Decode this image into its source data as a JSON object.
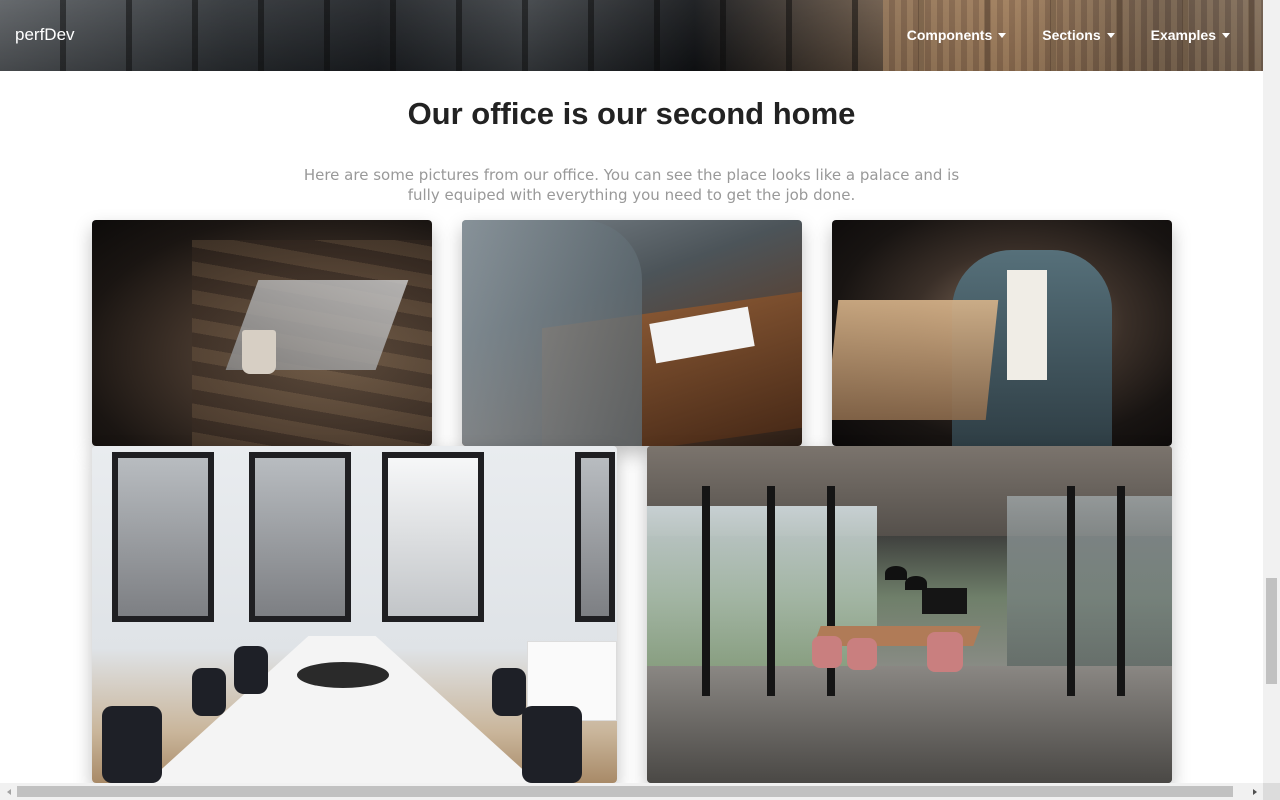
{
  "navbar": {
    "brand": "perfDev",
    "items": [
      {
        "label": "Components"
      },
      {
        "label": "Sections"
      },
      {
        "label": "Examples"
      }
    ]
  },
  "section": {
    "title": "Our office is our second home",
    "description": "Here are some pictures from our office. You can see the place looks like a palace and is fully equiped with everything you need to get the job done."
  },
  "gallery": {
    "images": [
      {
        "subject": "hands typing on laptop at wooden table with coffee mug"
      },
      {
        "subject": "two people at a wooden desk writing on paper"
      },
      {
        "subject": "woman working on laptop in dim light"
      },
      {
        "subject": "white conference room with black chairs and windows"
      },
      {
        "subject": "open office with glass walls and pink chairs"
      }
    ]
  },
  "icons": {
    "dropdown": "caret-down-icon",
    "scroll_left": "arrow-left-icon",
    "scroll_right": "arrow-right-icon"
  }
}
